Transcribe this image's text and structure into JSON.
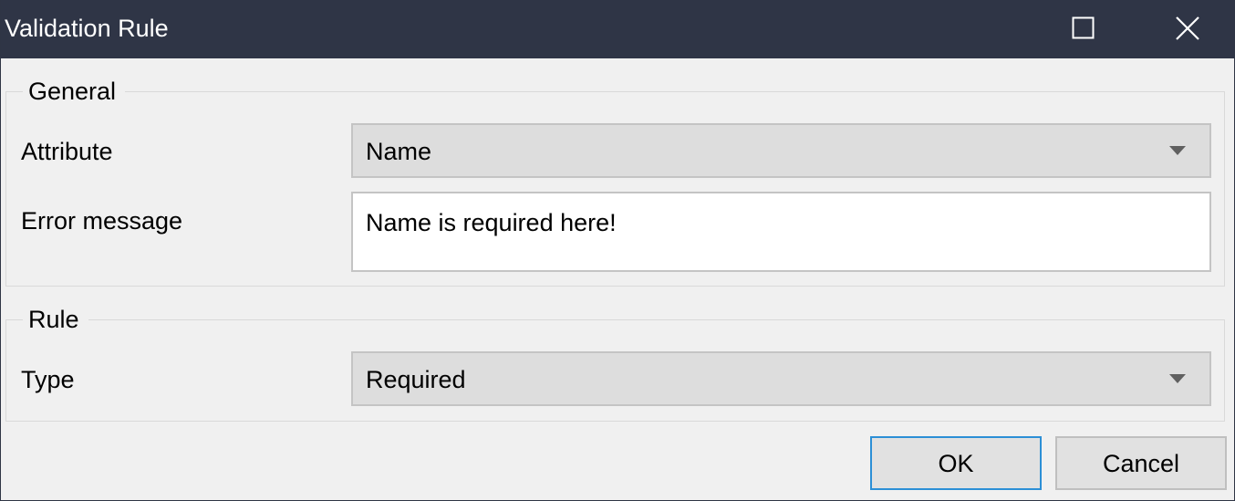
{
  "window": {
    "title": "Validation Rule",
    "maximize_icon": "maximize-icon",
    "close_icon": "close-icon"
  },
  "general": {
    "legend": "General",
    "attribute_label": "Attribute",
    "attribute_value": "Name",
    "error_message_label": "Error message",
    "error_message_value": "Name is required here!"
  },
  "rule": {
    "legend": "Rule",
    "type_label": "Type",
    "type_value": "Required"
  },
  "buttons": {
    "ok_label": "OK",
    "cancel_label": "Cancel"
  },
  "colors": {
    "titlebar": "#2f3546",
    "window_bg": "#f0f0f0",
    "focus_border": "#2c8fd6"
  }
}
